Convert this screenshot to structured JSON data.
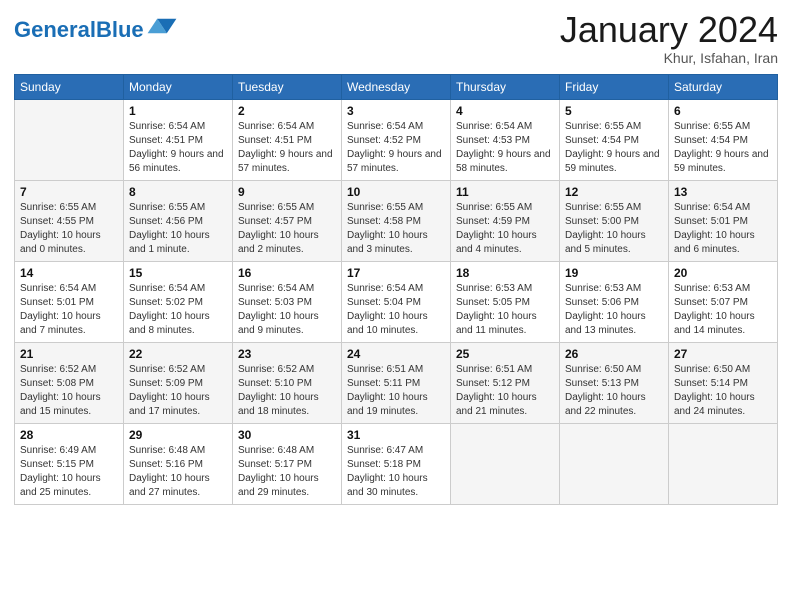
{
  "header": {
    "logo_general": "General",
    "logo_blue": "Blue",
    "month_title": "January 2024",
    "subtitle": "Khur, Isfahan, Iran"
  },
  "days_of_week": [
    "Sunday",
    "Monday",
    "Tuesday",
    "Wednesday",
    "Thursday",
    "Friday",
    "Saturday"
  ],
  "weeks": [
    [
      {
        "day": "",
        "sunrise": "",
        "sunset": "",
        "daylight": ""
      },
      {
        "day": "1",
        "sunrise": "Sunrise: 6:54 AM",
        "sunset": "Sunset: 4:51 PM",
        "daylight": "Daylight: 9 hours and 56 minutes."
      },
      {
        "day": "2",
        "sunrise": "Sunrise: 6:54 AM",
        "sunset": "Sunset: 4:51 PM",
        "daylight": "Daylight: 9 hours and 57 minutes."
      },
      {
        "day": "3",
        "sunrise": "Sunrise: 6:54 AM",
        "sunset": "Sunset: 4:52 PM",
        "daylight": "Daylight: 9 hours and 57 minutes."
      },
      {
        "day": "4",
        "sunrise": "Sunrise: 6:54 AM",
        "sunset": "Sunset: 4:53 PM",
        "daylight": "Daylight: 9 hours and 58 minutes."
      },
      {
        "day": "5",
        "sunrise": "Sunrise: 6:55 AM",
        "sunset": "Sunset: 4:54 PM",
        "daylight": "Daylight: 9 hours and 59 minutes."
      },
      {
        "day": "6",
        "sunrise": "Sunrise: 6:55 AM",
        "sunset": "Sunset: 4:54 PM",
        "daylight": "Daylight: 9 hours and 59 minutes."
      }
    ],
    [
      {
        "day": "7",
        "sunrise": "Sunrise: 6:55 AM",
        "sunset": "Sunset: 4:55 PM",
        "daylight": "Daylight: 10 hours and 0 minutes."
      },
      {
        "day": "8",
        "sunrise": "Sunrise: 6:55 AM",
        "sunset": "Sunset: 4:56 PM",
        "daylight": "Daylight: 10 hours and 1 minute."
      },
      {
        "day": "9",
        "sunrise": "Sunrise: 6:55 AM",
        "sunset": "Sunset: 4:57 PM",
        "daylight": "Daylight: 10 hours and 2 minutes."
      },
      {
        "day": "10",
        "sunrise": "Sunrise: 6:55 AM",
        "sunset": "Sunset: 4:58 PM",
        "daylight": "Daylight: 10 hours and 3 minutes."
      },
      {
        "day": "11",
        "sunrise": "Sunrise: 6:55 AM",
        "sunset": "Sunset: 4:59 PM",
        "daylight": "Daylight: 10 hours and 4 minutes."
      },
      {
        "day": "12",
        "sunrise": "Sunrise: 6:55 AM",
        "sunset": "Sunset: 5:00 PM",
        "daylight": "Daylight: 10 hours and 5 minutes."
      },
      {
        "day": "13",
        "sunrise": "Sunrise: 6:54 AM",
        "sunset": "Sunset: 5:01 PM",
        "daylight": "Daylight: 10 hours and 6 minutes."
      }
    ],
    [
      {
        "day": "14",
        "sunrise": "Sunrise: 6:54 AM",
        "sunset": "Sunset: 5:01 PM",
        "daylight": "Daylight: 10 hours and 7 minutes."
      },
      {
        "day": "15",
        "sunrise": "Sunrise: 6:54 AM",
        "sunset": "Sunset: 5:02 PM",
        "daylight": "Daylight: 10 hours and 8 minutes."
      },
      {
        "day": "16",
        "sunrise": "Sunrise: 6:54 AM",
        "sunset": "Sunset: 5:03 PM",
        "daylight": "Daylight: 10 hours and 9 minutes."
      },
      {
        "day": "17",
        "sunrise": "Sunrise: 6:54 AM",
        "sunset": "Sunset: 5:04 PM",
        "daylight": "Daylight: 10 hours and 10 minutes."
      },
      {
        "day": "18",
        "sunrise": "Sunrise: 6:53 AM",
        "sunset": "Sunset: 5:05 PM",
        "daylight": "Daylight: 10 hours and 11 minutes."
      },
      {
        "day": "19",
        "sunrise": "Sunrise: 6:53 AM",
        "sunset": "Sunset: 5:06 PM",
        "daylight": "Daylight: 10 hours and 13 minutes."
      },
      {
        "day": "20",
        "sunrise": "Sunrise: 6:53 AM",
        "sunset": "Sunset: 5:07 PM",
        "daylight": "Daylight: 10 hours and 14 minutes."
      }
    ],
    [
      {
        "day": "21",
        "sunrise": "Sunrise: 6:52 AM",
        "sunset": "Sunset: 5:08 PM",
        "daylight": "Daylight: 10 hours and 15 minutes."
      },
      {
        "day": "22",
        "sunrise": "Sunrise: 6:52 AM",
        "sunset": "Sunset: 5:09 PM",
        "daylight": "Daylight: 10 hours and 17 minutes."
      },
      {
        "day": "23",
        "sunrise": "Sunrise: 6:52 AM",
        "sunset": "Sunset: 5:10 PM",
        "daylight": "Daylight: 10 hours and 18 minutes."
      },
      {
        "day": "24",
        "sunrise": "Sunrise: 6:51 AM",
        "sunset": "Sunset: 5:11 PM",
        "daylight": "Daylight: 10 hours and 19 minutes."
      },
      {
        "day": "25",
        "sunrise": "Sunrise: 6:51 AM",
        "sunset": "Sunset: 5:12 PM",
        "daylight": "Daylight: 10 hours and 21 minutes."
      },
      {
        "day": "26",
        "sunrise": "Sunrise: 6:50 AM",
        "sunset": "Sunset: 5:13 PM",
        "daylight": "Daylight: 10 hours and 22 minutes."
      },
      {
        "day": "27",
        "sunrise": "Sunrise: 6:50 AM",
        "sunset": "Sunset: 5:14 PM",
        "daylight": "Daylight: 10 hours and 24 minutes."
      }
    ],
    [
      {
        "day": "28",
        "sunrise": "Sunrise: 6:49 AM",
        "sunset": "Sunset: 5:15 PM",
        "daylight": "Daylight: 10 hours and 25 minutes."
      },
      {
        "day": "29",
        "sunrise": "Sunrise: 6:48 AM",
        "sunset": "Sunset: 5:16 PM",
        "daylight": "Daylight: 10 hours and 27 minutes."
      },
      {
        "day": "30",
        "sunrise": "Sunrise: 6:48 AM",
        "sunset": "Sunset: 5:17 PM",
        "daylight": "Daylight: 10 hours and 29 minutes."
      },
      {
        "day": "31",
        "sunrise": "Sunrise: 6:47 AM",
        "sunset": "Sunset: 5:18 PM",
        "daylight": "Daylight: 10 hours and 30 minutes."
      },
      {
        "day": "",
        "sunrise": "",
        "sunset": "",
        "daylight": ""
      },
      {
        "day": "",
        "sunrise": "",
        "sunset": "",
        "daylight": ""
      },
      {
        "day": "",
        "sunrise": "",
        "sunset": "",
        "daylight": ""
      }
    ]
  ]
}
